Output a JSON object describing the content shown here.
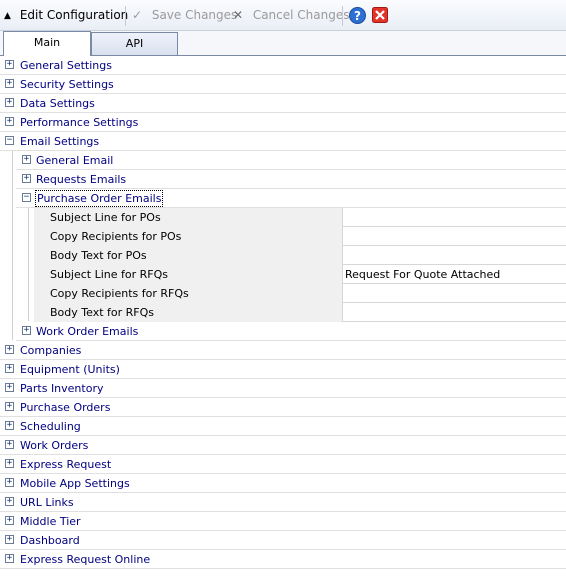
{
  "toolbar": {
    "edit_label": "Edit Configuration",
    "save_label": "Save Changes",
    "cancel_label": "Cancel Changes",
    "help_icon": "help-icon",
    "close_icon": "close-icon"
  },
  "tabs": [
    {
      "label": "Main",
      "active": true
    },
    {
      "label": "API",
      "active": false
    }
  ],
  "tree": {
    "top_groups_before": [
      {
        "label": "General Settings",
        "expanded": false
      },
      {
        "label": "Security Settings",
        "expanded": false
      },
      {
        "label": "Data Settings",
        "expanded": false
      },
      {
        "label": "Performance Settings",
        "expanded": false
      }
    ],
    "email_settings": {
      "label": "Email Settings",
      "expanded": true,
      "children_before": [
        {
          "label": "General Email",
          "expanded": false
        },
        {
          "label": "Requests Emails",
          "expanded": false
        }
      ],
      "purchase_order_emails": {
        "label": "Purchase Order Emails",
        "expanded": true,
        "properties": [
          {
            "name": "Subject Line for POs",
            "value": ""
          },
          {
            "name": "Copy Recipients for POs",
            "value": ""
          },
          {
            "name": "Body Text for POs",
            "value": ""
          },
          {
            "name": "Subject Line for RFQs",
            "value": "Request For Quote Attached"
          },
          {
            "name": "Copy Recipients for RFQs",
            "value": ""
          },
          {
            "name": "Body Text for RFQs",
            "value": ""
          }
        ]
      },
      "children_after": [
        {
          "label": "Work Order Emails",
          "expanded": false
        }
      ]
    },
    "top_groups_after": [
      {
        "label": "Companies",
        "expanded": false
      },
      {
        "label": "Equipment (Units)",
        "expanded": false
      },
      {
        "label": "Parts Inventory",
        "expanded": false
      },
      {
        "label": "Purchase Orders",
        "expanded": false
      },
      {
        "label": "Scheduling",
        "expanded": false
      },
      {
        "label": "Work Orders",
        "expanded": false
      },
      {
        "label": "Express Request",
        "expanded": false
      },
      {
        "label": "Mobile App Settings",
        "expanded": false
      },
      {
        "label": "URL Links",
        "expanded": false
      },
      {
        "label": "Middle Tier",
        "expanded": false
      },
      {
        "label": "Dashboard",
        "expanded": false
      },
      {
        "label": "Express Request Online",
        "expanded": false
      }
    ]
  }
}
